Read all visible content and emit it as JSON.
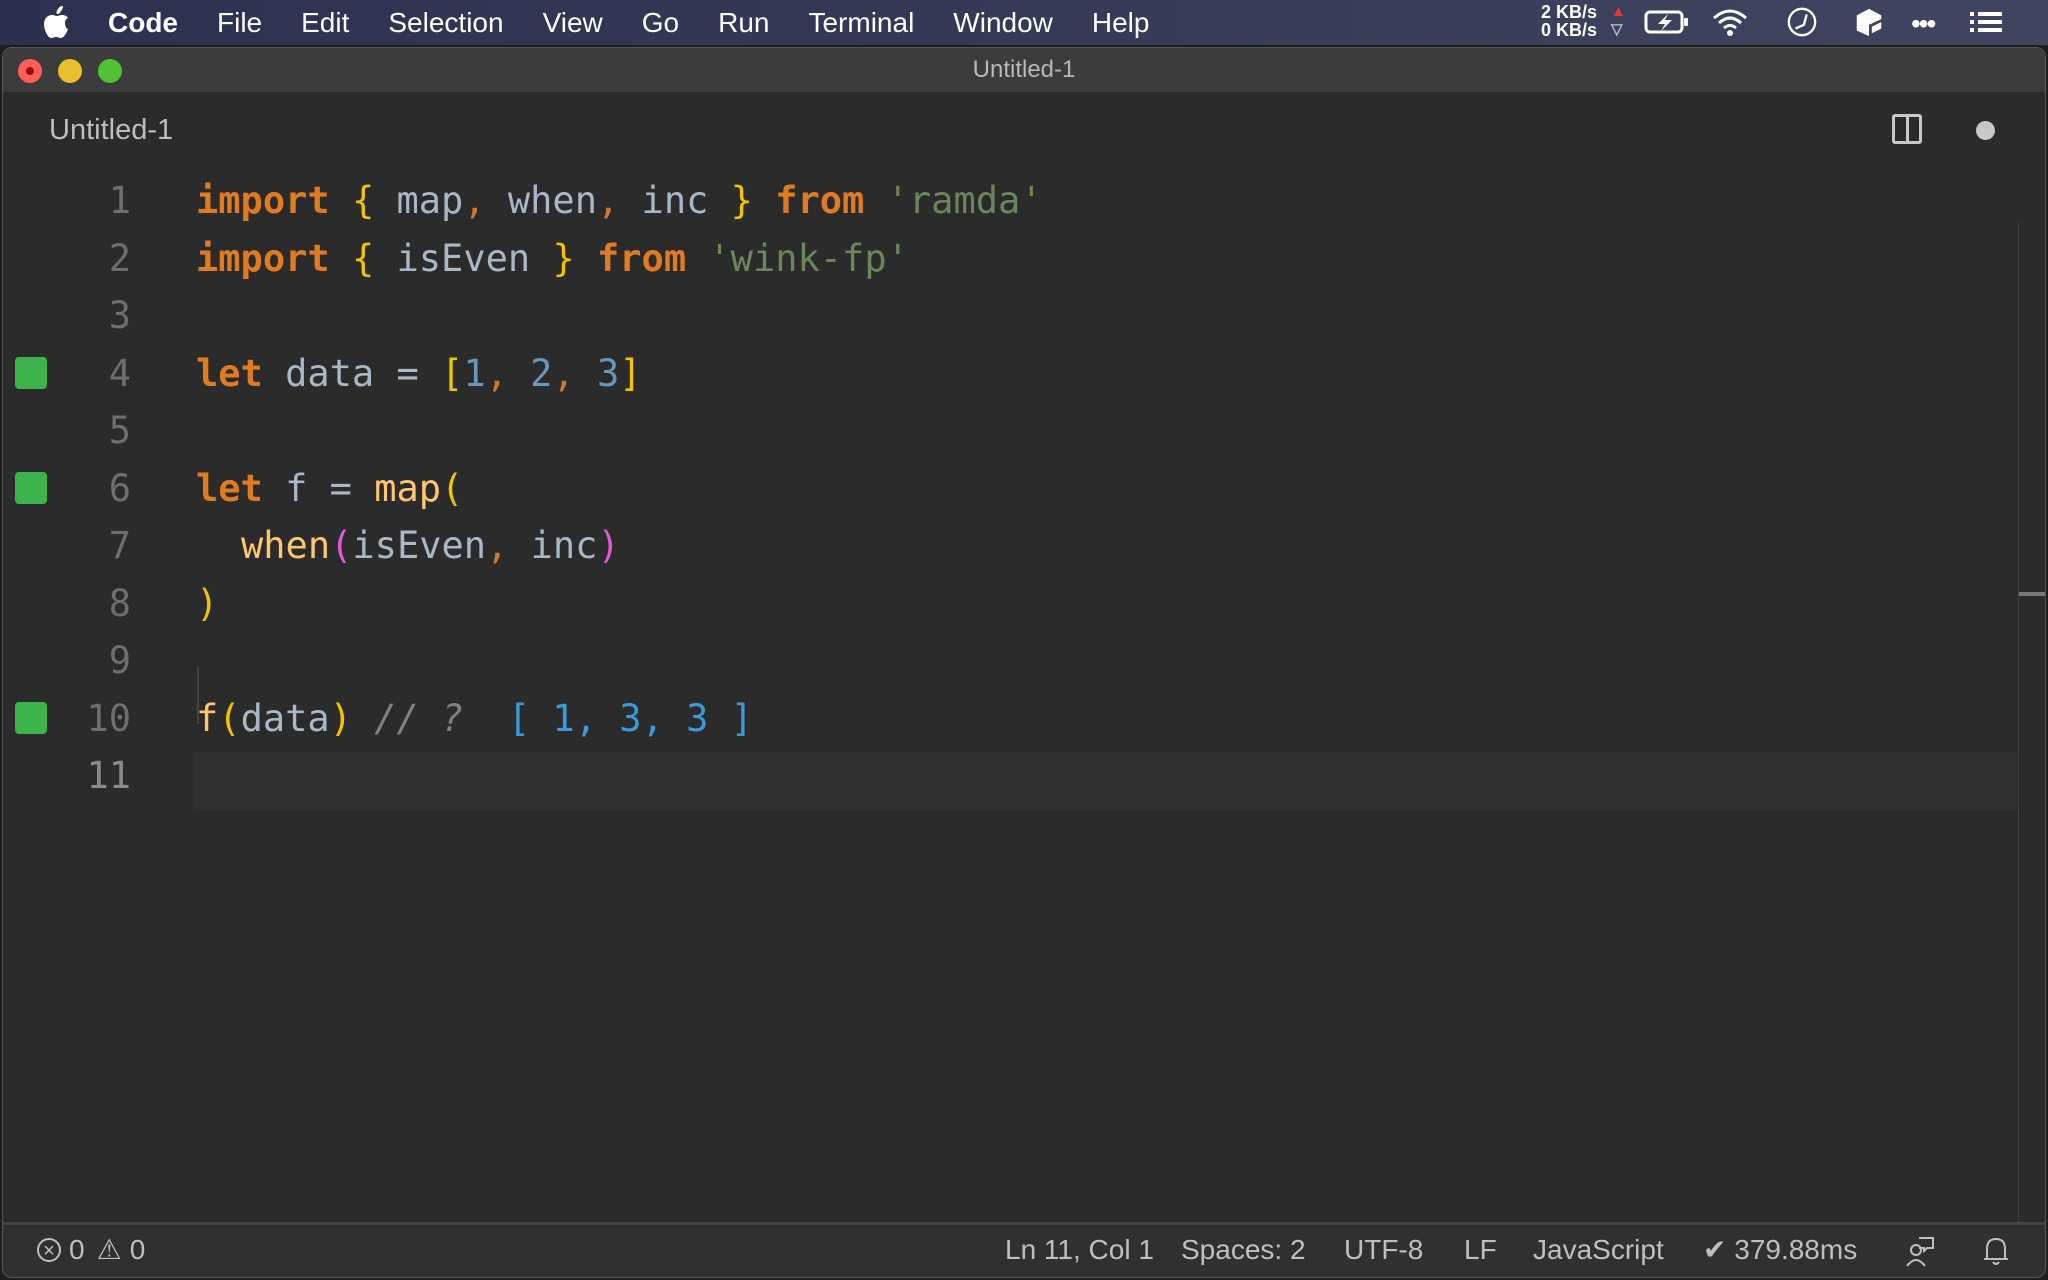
{
  "menubar": {
    "apple_icon": "apple-logo-icon",
    "app_name": "Code",
    "items": [
      "File",
      "Edit",
      "Selection",
      "View",
      "Go",
      "Run",
      "Terminal",
      "Window",
      "Help"
    ],
    "net_up": "2 KB/s",
    "net_down": "0 KB/s",
    "status_icons": [
      "battery-charging-icon",
      "wifi-icon",
      "clock-icon",
      "cube-icon",
      "more-icon",
      "list-icon"
    ]
  },
  "window": {
    "title": "Untitled-1"
  },
  "tab": {
    "title": "Untitled-1",
    "split_icon": "split-editor-icon",
    "dirty_icon": "unsaved-dot-icon"
  },
  "editor": {
    "lines": [
      {
        "number": "1",
        "marker": false
      },
      {
        "number": "2",
        "marker": false
      },
      {
        "number": "3",
        "marker": false
      },
      {
        "number": "4",
        "marker": true
      },
      {
        "number": "5",
        "marker": false
      },
      {
        "number": "6",
        "marker": true
      },
      {
        "number": "7",
        "marker": false
      },
      {
        "number": "8",
        "marker": false
      },
      {
        "number": "9",
        "marker": false
      },
      {
        "number": "10",
        "marker": true
      },
      {
        "number": "11",
        "marker": false
      }
    ],
    "code": {
      "l1": {
        "kw_import": "import",
        "open": "{",
        "ids": " map",
        "c1": ",",
        "id2": " when",
        "c2": ",",
        "id3": " inc ",
        "close": "}",
        "kw_from": "from",
        "str": "'ramda'"
      },
      "l2": {
        "kw_import": "import",
        "open": "{",
        "id": " isEven ",
        "close": "}",
        "kw_from": "from",
        "str": "'wink-fp'"
      },
      "l4": {
        "kw": "let",
        "rest": " data = ",
        "open": "[",
        "n1": "1",
        "c1": ", ",
        "n2": "2",
        "c2": ", ",
        "n3": "3",
        "close": "]"
      },
      "l6": {
        "kw": "let",
        "rest": " f = ",
        "fn": "map",
        "open": "("
      },
      "l7": {
        "fn": "when",
        "open": "(",
        "a1": "isEven",
        "comma": ",",
        "a2": " inc",
        "close": ")"
      },
      "l8": {
        "close": ")"
      },
      "l10": {
        "fn": "f",
        "open": "(",
        "arg": "data",
        "close": ")",
        "comment": " // ? ",
        "result": " [ 1, 3, 3 ]"
      }
    },
    "quokka_marker_color": "#3cb44b"
  },
  "statusbar": {
    "errors": "0",
    "warnings": "0",
    "position": "Ln 11, Col 1",
    "spaces": "Spaces: 2",
    "encoding": "UTF-8",
    "eol": "LF",
    "language": "JavaScript",
    "timing": "✔ 379.88ms",
    "feedback_icon": "feedback-person-icon",
    "bell_icon": "notification-bell-icon"
  }
}
